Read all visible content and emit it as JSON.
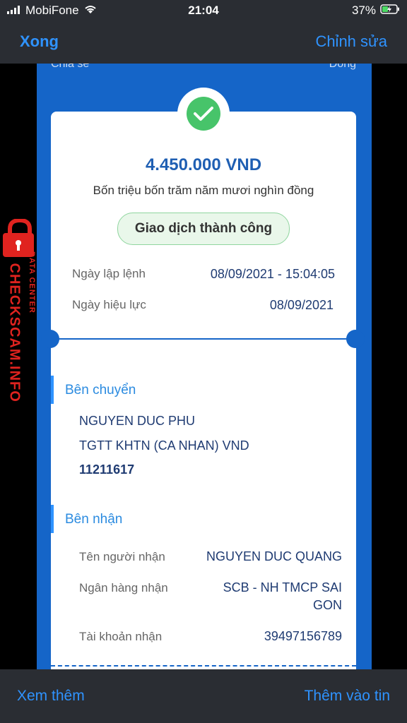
{
  "status_bar": {
    "carrier": "MobiFone",
    "time": "21:04",
    "battery": "37%"
  },
  "nav": {
    "done": "Xong",
    "edit": "Chỉnh sửa"
  },
  "peek": {
    "share": "Chia sẻ",
    "close": "Đóng"
  },
  "receipt": {
    "amount": "4.450.000 VND",
    "amount_words": "Bốn triệu bốn trăm năm mươi nghìn đồng",
    "status": "Giao dịch thành công",
    "order_date_label": "Ngày lập lệnh",
    "order_date_value": "08/09/2021 - 15:04:05",
    "effective_date_label": "Ngày hiệu lực",
    "effective_date_value": "08/09/2021"
  },
  "sender": {
    "title": "Bên chuyển",
    "name": "NGUYEN DUC PHU",
    "account_type": "TGTT KHTN (CA NHAN) VND",
    "account_number": "11211617"
  },
  "recipient": {
    "title": "Bên nhận",
    "name_label": "Tên người nhận",
    "name_value": "NGUYEN DUC QUANG",
    "bank_label": "Ngân hàng nhận",
    "bank_value_line1": "SCB - NH TMCP SAI",
    "bank_value_line2": "GON",
    "account_label": "Tài khoản nhận",
    "account_value": "39497156789"
  },
  "watermark": {
    "brand": "CHECKSCAM.INFO",
    "sub": "DATA CENTER"
  },
  "bottom": {
    "more": "Xem thêm",
    "add": "Thêm vào tin"
  },
  "colors": {
    "accent": "#2f93ff",
    "frame_blue": "#1565c8",
    "success_green": "#47c46a",
    "watermark_red": "#e0231f"
  }
}
